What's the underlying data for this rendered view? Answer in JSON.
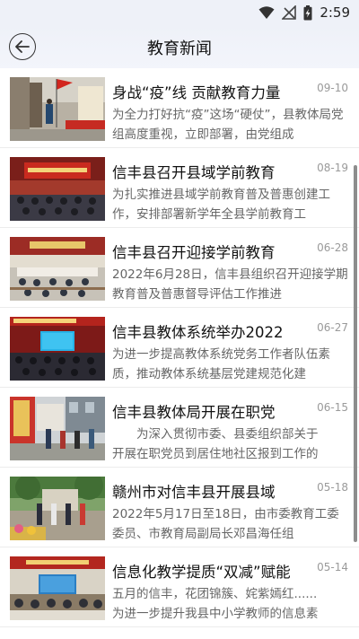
{
  "status": {
    "time": "2:59"
  },
  "header": {
    "title": "教育新闻"
  },
  "news": [
    {
      "title": "身战“疫”线 贡献教育力量",
      "date": "09-10",
      "summary": "为全力打好抗“疫”这场“硬仗”，县教体局党组高度重视，立即部署，由党组成"
    },
    {
      "title": "信丰县召开县域学前教育",
      "date": "08-19",
      "summary": "为扎实推进县域学前教育普及普惠创建工作，安排部署新学年全县学前教育工"
    },
    {
      "title": "信丰县召开迎接学前教育",
      "date": "06-28",
      "summary": "2022年6月28日，信丰县组织召开迎接学期教育普及普惠督导评估工作推进"
    },
    {
      "title": "信丰县教体系统举办2022",
      "date": "06-27",
      "summary": "为进一步提高教体系统党务工作者队伍素质，推动教体系统基层党建规范化建"
    },
    {
      "title": "信丰县教体局开展在职党",
      "date": "06-15",
      "summary": "　　为深入贯彻市委、县委组织部关于\n开展在职党员到居住地社区报到工作的"
    },
    {
      "title": "赣州市对信丰县开展县域",
      "date": "05-18",
      "summary": "2022年5月17日至18日，由市委教育工委委员、市教育局副局长邓昌海任组"
    },
    {
      "title": "信息化教学提质“双减”赋能",
      "date": "05-14",
      "summary": "五月的信丰，花团锦簇、姹紫嫣红......\n为进一步提升我县中小学教师的信息素"
    }
  ],
  "icons": {
    "back": "back-arrow-icon",
    "wifi": "wifi-icon",
    "signal": "no-signal-icon",
    "battery": "battery-charging-icon"
  }
}
